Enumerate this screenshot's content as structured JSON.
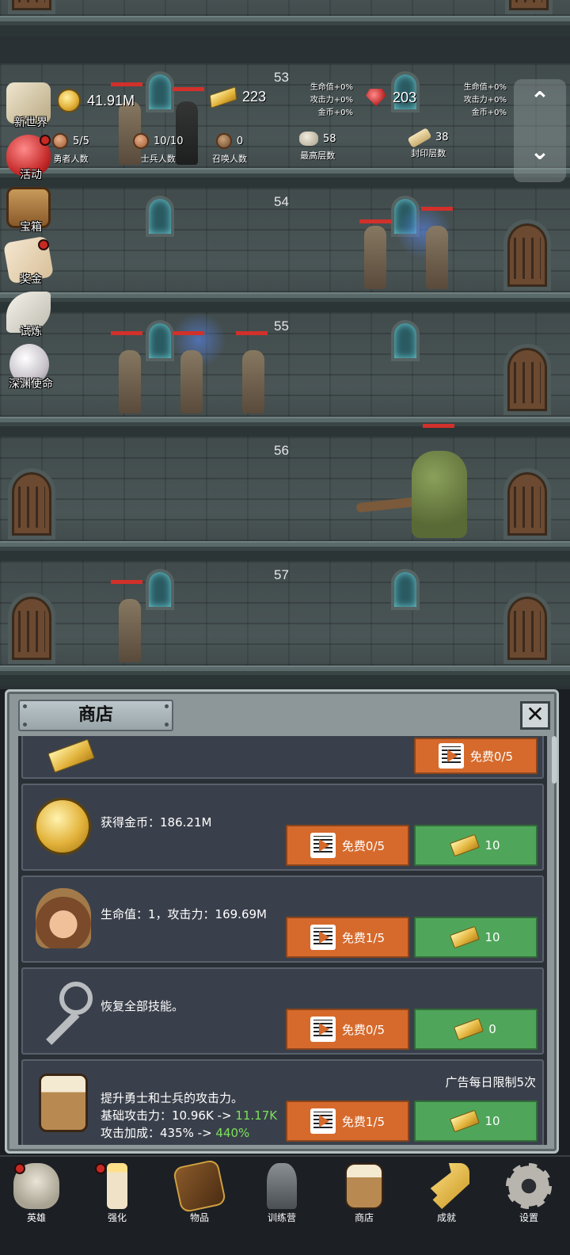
{
  "floors": [
    {
      "number": "53"
    },
    {
      "number": "54"
    },
    {
      "number": "55"
    },
    {
      "number": "56"
    },
    {
      "number": "57"
    }
  ],
  "resources": {
    "gold": "41.91M",
    "gold_bars": "223",
    "rubies": "203",
    "gold_bar_bonus": [
      "生命值+0%",
      "攻击力+0%",
      "金币+0%"
    ],
    "ruby_bonus": [
      "生命值+0%",
      "攻击力+0%",
      "金币+0%"
    ]
  },
  "stats": [
    {
      "value": "5/5",
      "label": "勇者人数",
      "icon": "hero-head-icon"
    },
    {
      "value": "10/10",
      "label": "士兵人数",
      "icon": "soldier-head-icon"
    },
    {
      "value": "0",
      "label": "召唤人数",
      "icon": "summon-head-icon"
    },
    {
      "value": "58",
      "label": "最高层数",
      "icon": "rock-icon"
    },
    {
      "value": "38",
      "label": "封印层数",
      "icon": "scroll-icon"
    }
  ],
  "side_menu": [
    {
      "label": "新世界",
      "icon": "map-icon"
    },
    {
      "label": "活动",
      "icon": "heart-icon"
    },
    {
      "label": "宝箱",
      "icon": "chest-icon"
    },
    {
      "label": "奖金",
      "icon": "envelope-icon"
    },
    {
      "label": "试炼",
      "icon": "feather-icon"
    },
    {
      "label": "深渊使命",
      "icon": "pearl-icon"
    }
  ],
  "scroll": {
    "up": "⌃",
    "down": "⌄"
  },
  "shop": {
    "title": "商店",
    "close": "✕",
    "top_partial_button": "免费0/5",
    "items": [
      {
        "desc": "获得金币：186.21M",
        "ad_label": "免费0/5",
        "price": "10",
        "icon": "gold-coin-icon"
      },
      {
        "desc": "生命值：1，攻击力：169.69M",
        "ad_label": "免费1/5",
        "price": "10",
        "icon": "hero-portrait-icon"
      },
      {
        "desc": "恢复全部技能。",
        "ad_label": "免费0/5",
        "price": "0",
        "icon": "key-icon"
      },
      {
        "desc_line1": "提升勇士和士兵的攻击力。",
        "desc_line2_prefix": "基础攻击力：10.96K -> ",
        "desc_line2_value": "11.17K",
        "desc_line3_prefix": "攻击加成：435% -> ",
        "desc_line3_value": "440%",
        "limit": "广告每日限制5次",
        "ad_label": "免费1/5",
        "price": "10",
        "icon": "beer-mug-icon"
      }
    ]
  },
  "bottom_nav": [
    {
      "label": "英雄",
      "icon": "skull-icon"
    },
    {
      "label": "强化",
      "icon": "candle-icon"
    },
    {
      "label": "物品",
      "icon": "book-icon"
    },
    {
      "label": "训练营",
      "icon": "lantern-icon"
    },
    {
      "label": "商店",
      "icon": "beer-mug-icon"
    },
    {
      "label": "成就",
      "icon": "key-icon"
    },
    {
      "label": "设置",
      "icon": "gear-icon"
    }
  ],
  "colors": {
    "ad_button": "#d66a2c",
    "gold_button": "#4fa65a",
    "hp_bar": "#d2302a",
    "highlight": "#7ce05a"
  }
}
